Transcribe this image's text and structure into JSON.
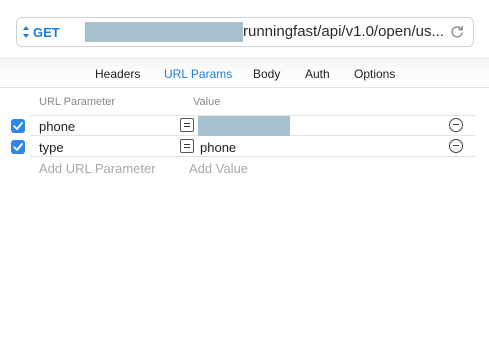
{
  "request": {
    "method": "GET",
    "url_visible": "runningfast/api/v1.0/open/us..."
  },
  "tabs": [
    {
      "label": "Headers"
    },
    {
      "label": "URL Params",
      "active": true
    },
    {
      "label": "Body"
    },
    {
      "label": "Auth"
    },
    {
      "label": "Options"
    }
  ],
  "params_table": {
    "column_headers": {
      "name": "URL Parameter",
      "value": "Value"
    },
    "rows": [
      {
        "enabled": true,
        "name": "phone",
        "value": ""
      },
      {
        "enabled": true,
        "name": "type",
        "value": "phone"
      }
    ],
    "add_name_placeholder": "Add URL Parameter",
    "add_value_placeholder": "Add Value"
  },
  "colors": {
    "accent": "#1a7fd9",
    "checkbox": "#2f86e6",
    "redaction": "#a7c1cf"
  }
}
